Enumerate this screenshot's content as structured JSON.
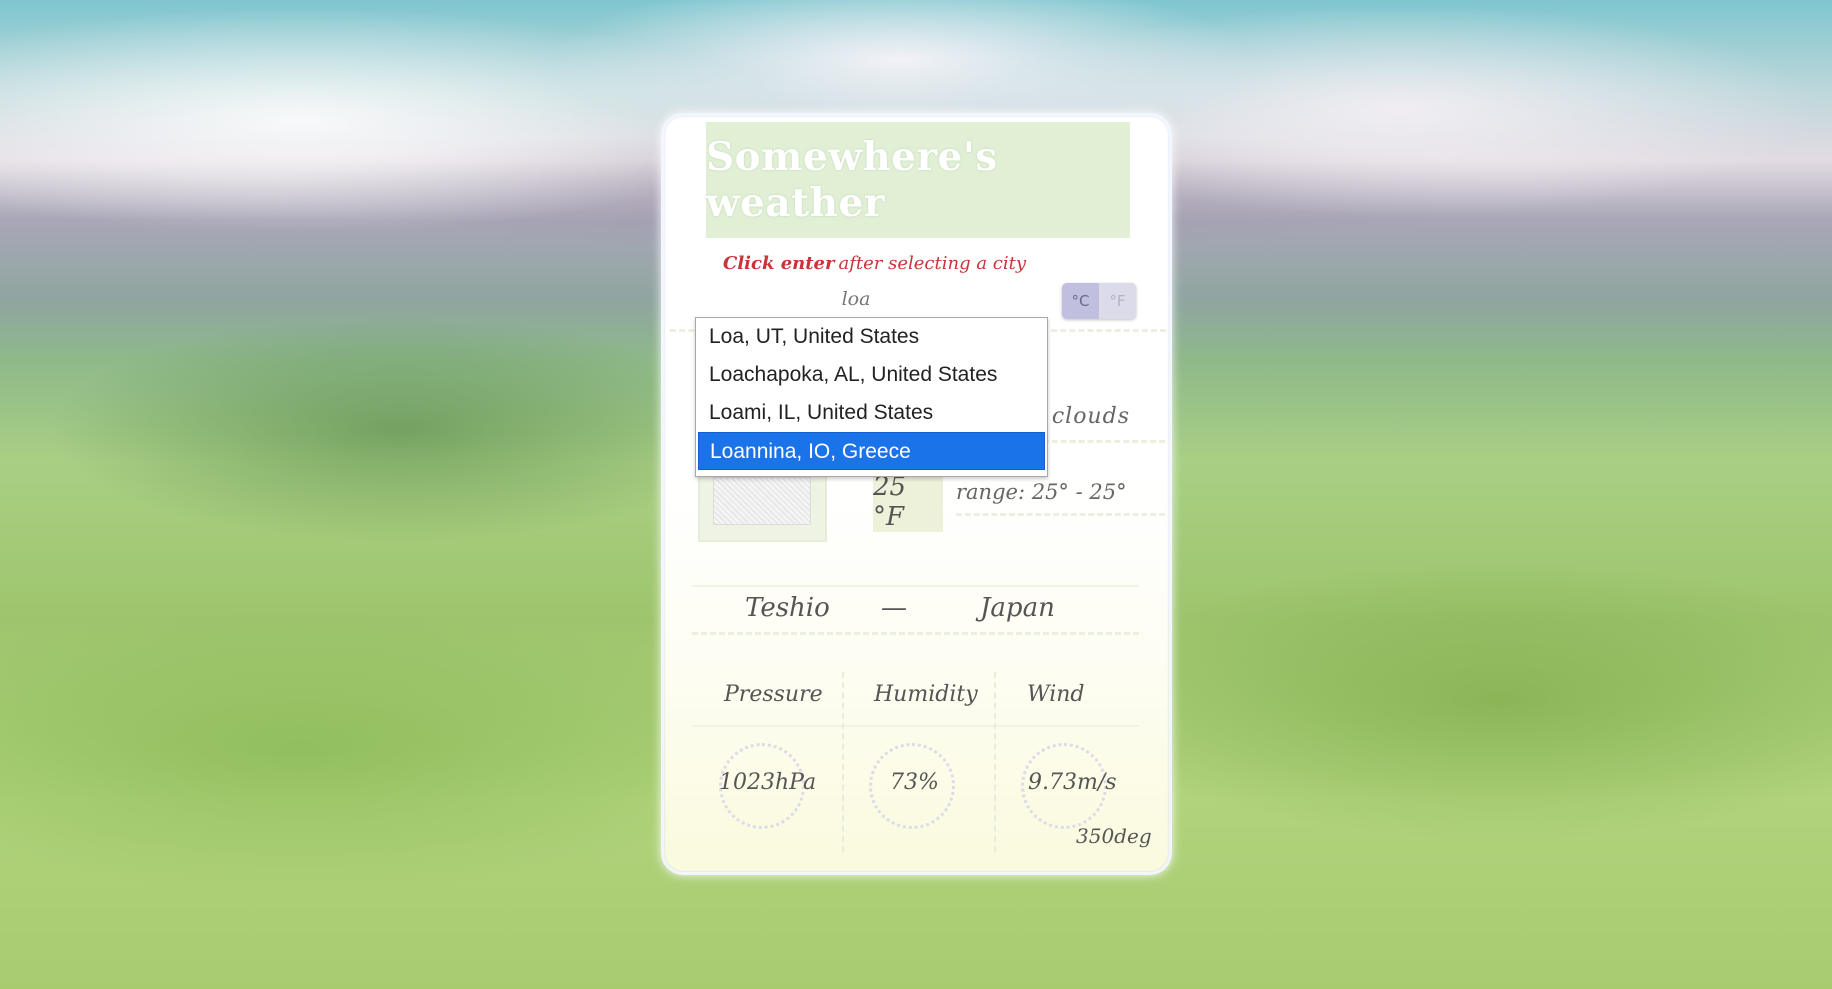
{
  "app": {
    "title": "Somewhere's weather",
    "hint_bold": "Click enter",
    "hint_rest": "after selecting a city"
  },
  "search": {
    "value": "loa",
    "placeholder": ""
  },
  "units": {
    "celsius": "°C",
    "fahrenheit": "°F",
    "selected": "celsius"
  },
  "autocomplete": {
    "items": [
      "Loa, UT, United States",
      "Loachapoka, AL, United States",
      "Loami, IL, United States",
      "Loannina, IO, Greece"
    ],
    "highlighted_index": 3
  },
  "weather": {
    "description_visible": "t clouds",
    "temperature": "25 °F",
    "range": "range: 25° - 25°"
  },
  "location": {
    "city": "Teshio",
    "separator": "—",
    "country": "Japan"
  },
  "stats": {
    "pressure_label": "Pressure",
    "humidity_label": "Humidity",
    "wind_label": "Wind",
    "pressure_value": "1023hPa",
    "humidity_value": "73%",
    "wind_value": "9.73m/s",
    "wind_deg": "350deg"
  },
  "colors": {
    "hint": "#c8343a",
    "title_bg": "#e1f0d5",
    "dropdown_highlight": "#1a73e8"
  }
}
